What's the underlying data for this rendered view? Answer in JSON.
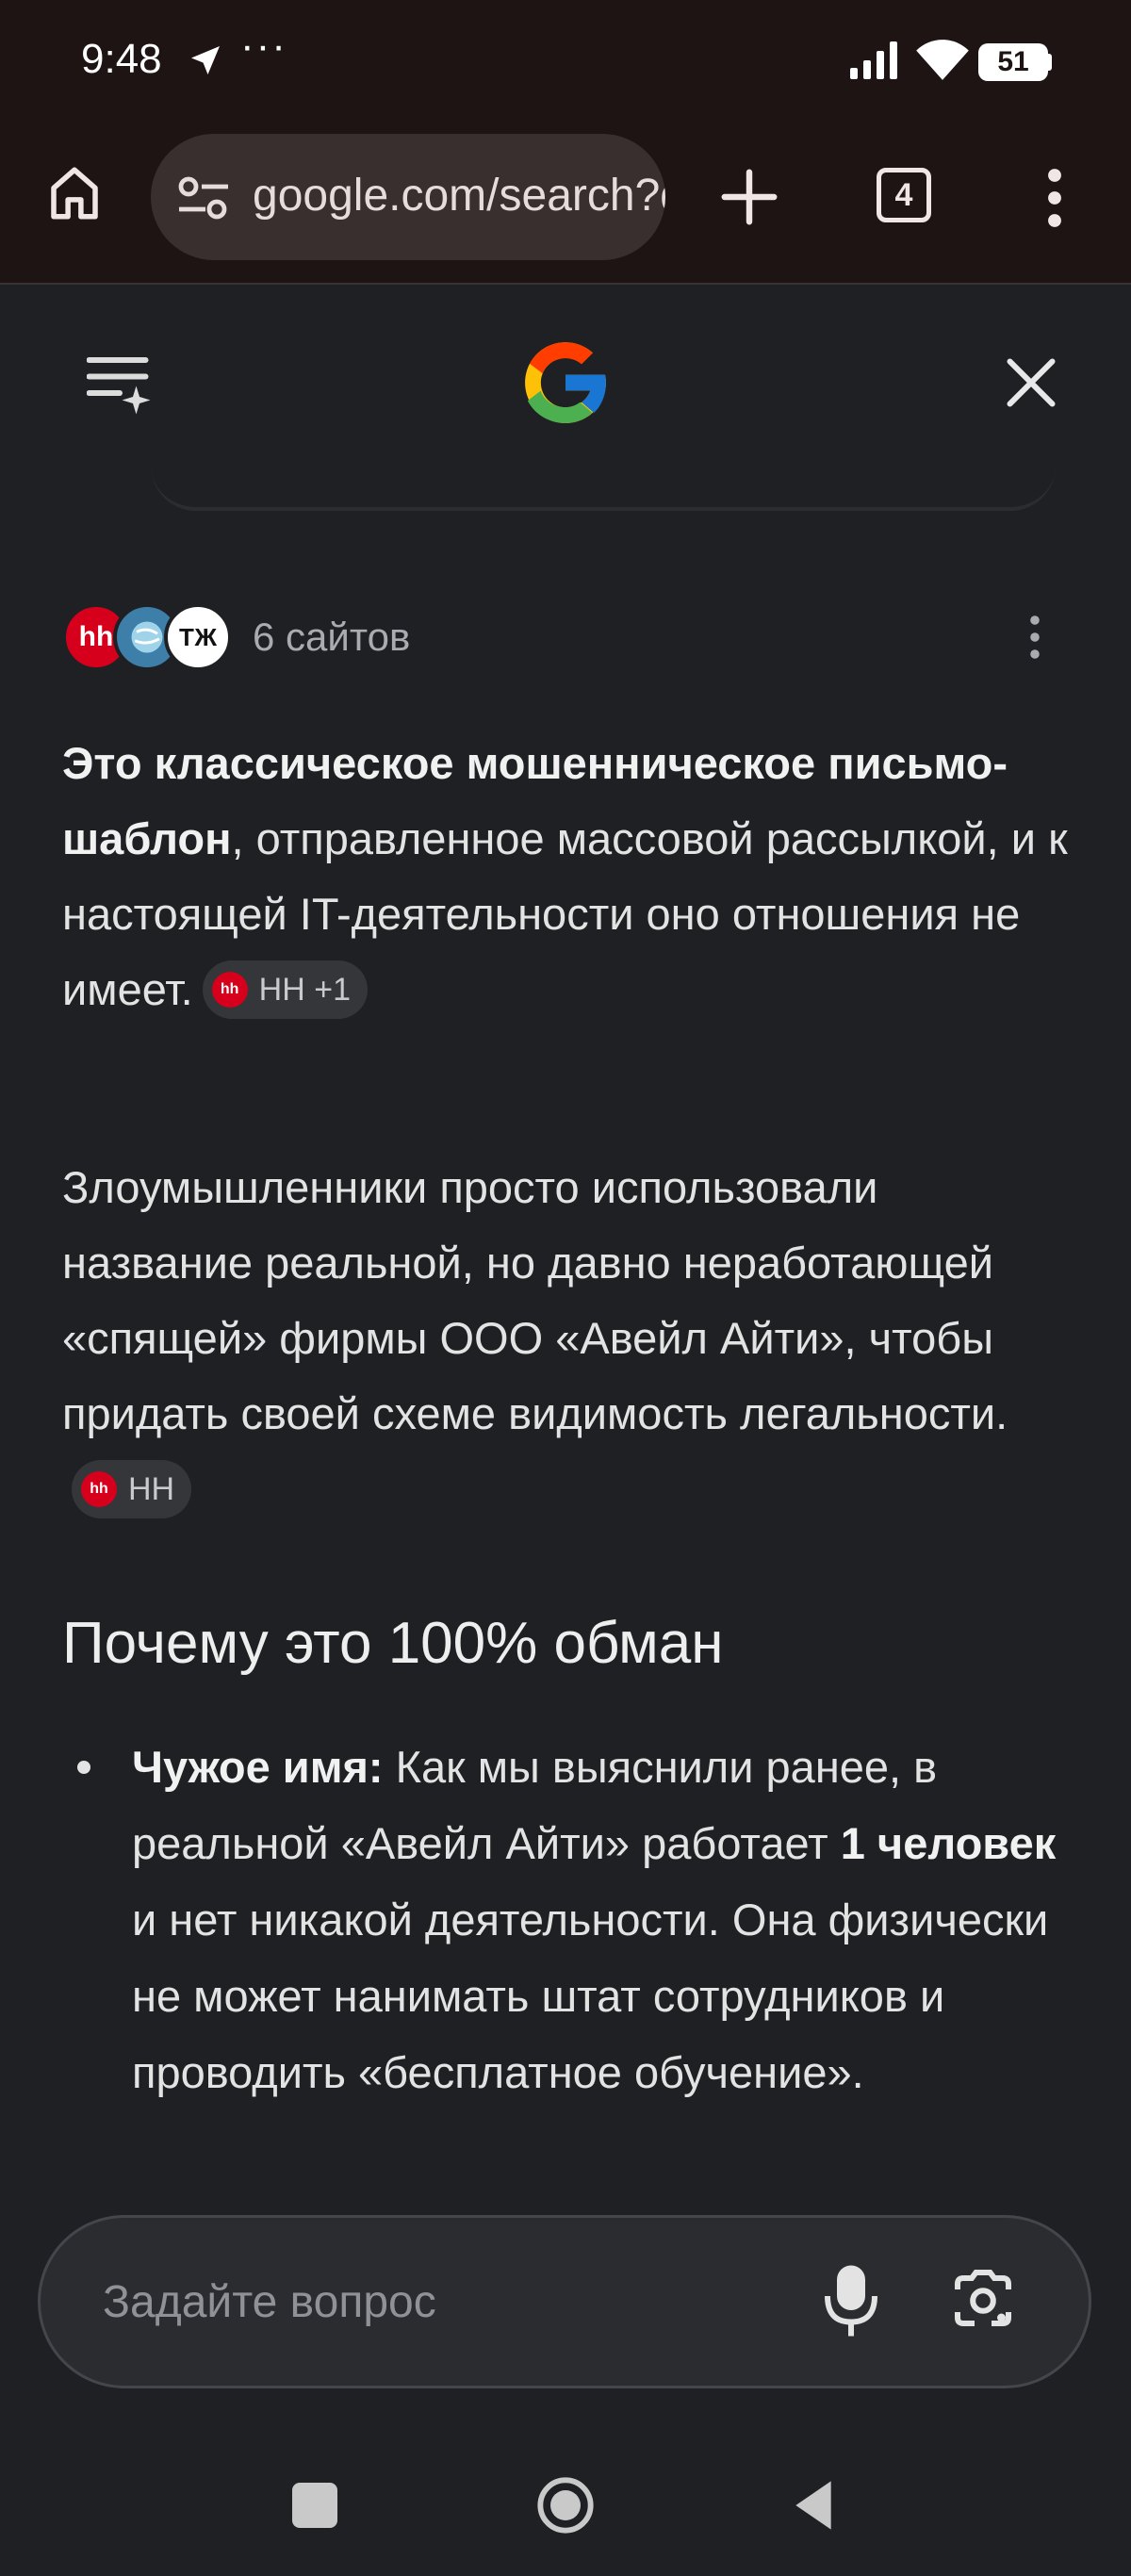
{
  "status_bar": {
    "time": "9:48",
    "dots": "···",
    "battery": "51"
  },
  "browser": {
    "url": "google.com/search?q=",
    "tab_count": "4"
  },
  "sources": {
    "label": "6 сайтов",
    "favicons": [
      "hh",
      "globe",
      "ТЖ"
    ],
    "tj_text": "Т​Ж",
    "hh_text": "hh"
  },
  "answer": {
    "p1_bold": "Это классическое мошенническое письмо-шаблон",
    "p1_rest": ", отправленное массовой рассылкой, и к настоящей IT-деятельности оно отношения не имеет.",
    "p1_chip": "HH +1",
    "p2_text": "Злоумышленники просто использовали название реальной, но давно неработающей «спящей» фирмы ООО «Авейл Айти», чтобы придать своей схеме видимость легальности.",
    "p2_chip": "HH",
    "chip_fav": "hh"
  },
  "section": {
    "heading": "Почему это 100% обман",
    "bullets": [
      {
        "lead": "Чужое имя:",
        "t1": " Как мы выяснили ранее, в реальной «Авейл Айти» работает ",
        "b2": "1 человек",
        "t2": " и нет никакой деятельности. Она физически не может нанимать штат сотрудников и проводить «бесплатное обучение»."
      }
    ]
  },
  "ask": {
    "placeholder": "Задайте вопрос"
  },
  "colors": {
    "background": "#1f2023",
    "chrome_bar": "#1e1414",
    "hh_red": "#d6001c"
  }
}
